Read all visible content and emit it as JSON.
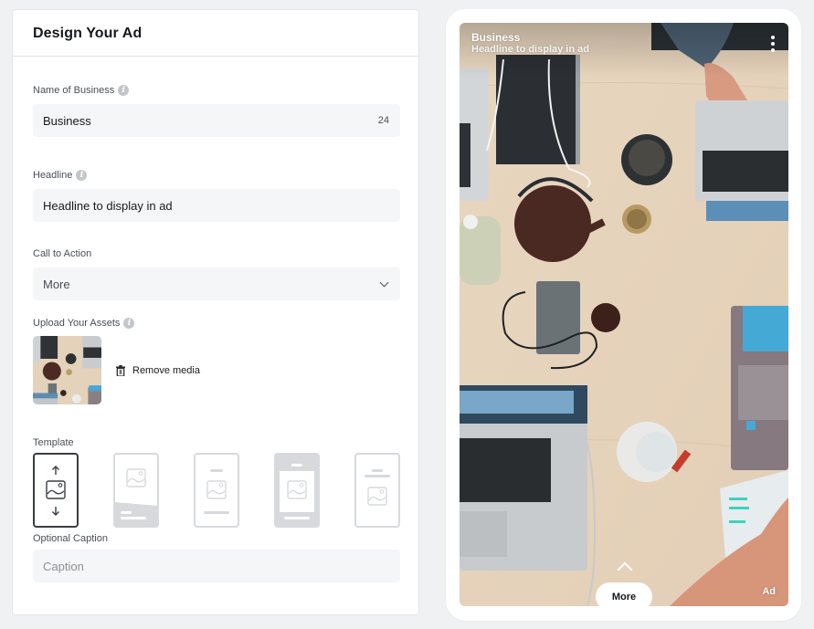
{
  "form": {
    "title": "Design Your Ad",
    "business_name": {
      "label": "Name of Business",
      "value": "Business",
      "remaining_chars": "24",
      "info_icon": "info-icon"
    },
    "headline": {
      "label": "Headline",
      "value": "Headline to display in ad",
      "info_icon": "info-icon"
    },
    "call_to_action": {
      "label": "Call to Action",
      "selected": "More",
      "icon": "chevron-down-icon"
    },
    "upload_assets": {
      "label": "Upload Your Assets",
      "info_icon": "info-icon",
      "remove_label": "Remove media",
      "remove_icon": "trash-icon"
    },
    "template": {
      "label": "Template",
      "options": [
        {
          "name": "full-bleed-scroll",
          "selected": true
        },
        {
          "name": "image-with-bottom-panel",
          "selected": false
        },
        {
          "name": "centered-image-outline",
          "selected": false
        },
        {
          "name": "framed-image-filled",
          "selected": false
        },
        {
          "name": "header-image",
          "selected": false
        }
      ]
    },
    "caption": {
      "label": "Optional Caption",
      "value": "",
      "placeholder": "Caption"
    }
  },
  "preview": {
    "business": "Business",
    "headline": "Headline to display in ad",
    "cta_label": "More",
    "ad_badge": "Ad",
    "menu_icon": "kebab-menu-icon",
    "swipe_icon": "chevron-up-icon"
  },
  "colors": {
    "panel_bg": "#ffffff",
    "page_bg": "#f0f1f3",
    "input_bg": "#f5f6f8",
    "selected_border": "#3a3d41",
    "template_gray": "#d7d9dc"
  }
}
